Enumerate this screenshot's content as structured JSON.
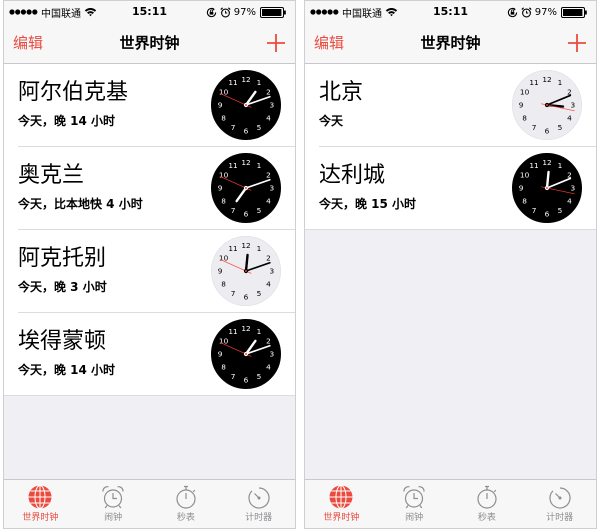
{
  "colors": {
    "accent": "#ea4b3f",
    "inactive": "#8e8e93",
    "second_hand": "#ff3b30"
  },
  "clock_numerals": [
    "1",
    "2",
    "3",
    "4",
    "5",
    "6",
    "7",
    "8",
    "9",
    "10",
    "11",
    "12"
  ],
  "panels": [
    {
      "status": {
        "carrier": "中国联通",
        "time": "15:11",
        "battery": "97%"
      },
      "nav": {
        "edit": "编辑",
        "title": "世界时钟",
        "add_icon": "add-icon"
      },
      "cities": [
        {
          "name": "阿尔伯克基",
          "offset": "今天，晚 14 小时",
          "clock": {
            "hour": 1,
            "minute": 11,
            "second": 49,
            "face": "dark"
          }
        },
        {
          "name": "奥克兰",
          "offset": "今天，比本地快 4 小时",
          "clock": {
            "hour": 19,
            "minute": 11,
            "second": 49,
            "face": "dark"
          }
        },
        {
          "name": "阿克托别",
          "offset": "今天，晚 3 小时",
          "clock": {
            "hour": 12,
            "minute": 11,
            "second": 49,
            "face": "light"
          }
        },
        {
          "name": "埃得蒙顿",
          "offset": "今天，晚 14 小时",
          "clock": {
            "hour": 1,
            "minute": 11,
            "second": 49,
            "face": "dark"
          }
        }
      ]
    },
    {
      "status": {
        "carrier": "中国联通",
        "time": "15:11",
        "battery": "97%"
      },
      "nav": {
        "edit": "编辑",
        "title": "世界时钟",
        "add_icon": "add-icon"
      },
      "cities": [
        {
          "name": "北京",
          "offset": "今天",
          "clock": {
            "hour": 15,
            "minute": 11,
            "second": 17,
            "face": "light"
          }
        },
        {
          "name": "达利城",
          "offset": "今天，晚 15 小时",
          "clock": {
            "hour": 0,
            "minute": 11,
            "second": 17,
            "face": "dark"
          }
        }
      ]
    }
  ],
  "status_icons": [
    "signal-icon",
    "wifi-icon",
    "rotation-lock-icon",
    "alarm-icon",
    "battery-icon"
  ],
  "tabs": [
    {
      "label": "世界时钟",
      "icon": "globe-icon",
      "active": true
    },
    {
      "label": "闹钟",
      "icon": "alarm-clock-icon",
      "active": false
    },
    {
      "label": "秒表",
      "icon": "stopwatch-icon",
      "active": false
    },
    {
      "label": "计时器",
      "icon": "timer-icon",
      "active": false
    }
  ]
}
